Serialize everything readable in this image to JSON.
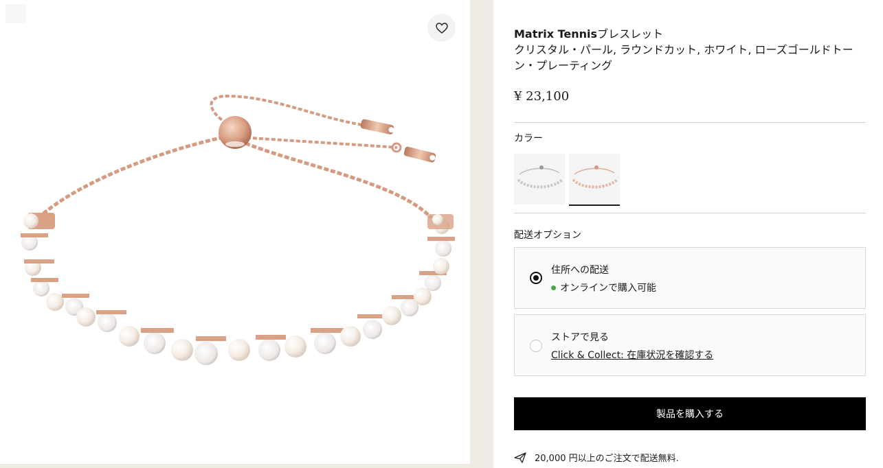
{
  "product": {
    "name_bold": "Matrix Tennis",
    "name_suffix": "ブレスレット",
    "description": "クリスタル・パール, ラウンドカット, ホワイト, ローズゴールドトーン・プレーティング",
    "price": "¥ 23,100"
  },
  "wishlist": {
    "icon": "heart-icon"
  },
  "color_section": {
    "label": "カラー",
    "swatches": [
      {
        "variant": "silver",
        "selected": false
      },
      {
        "variant": "rose-gold",
        "selected": true
      }
    ]
  },
  "delivery_section": {
    "label": "配送オプション",
    "options": [
      {
        "title": "住所への配送",
        "status": "オンラインで購入可能",
        "selected": true
      },
      {
        "title": "ストアで見る",
        "link": "Click & Collect: 在庫状況を確認する",
        "selected": false
      }
    ]
  },
  "buy_button": {
    "label": "製品を購入する"
  },
  "shipping_note": {
    "icon": "paper-plane-icon",
    "text": "20,000 円以上のご注文で配送無料."
  },
  "colors": {
    "rose_gold": "#d79a80",
    "buy_button_bg": "#000000",
    "status_green": "#4aa84a",
    "side_strip": "#eeece4"
  }
}
